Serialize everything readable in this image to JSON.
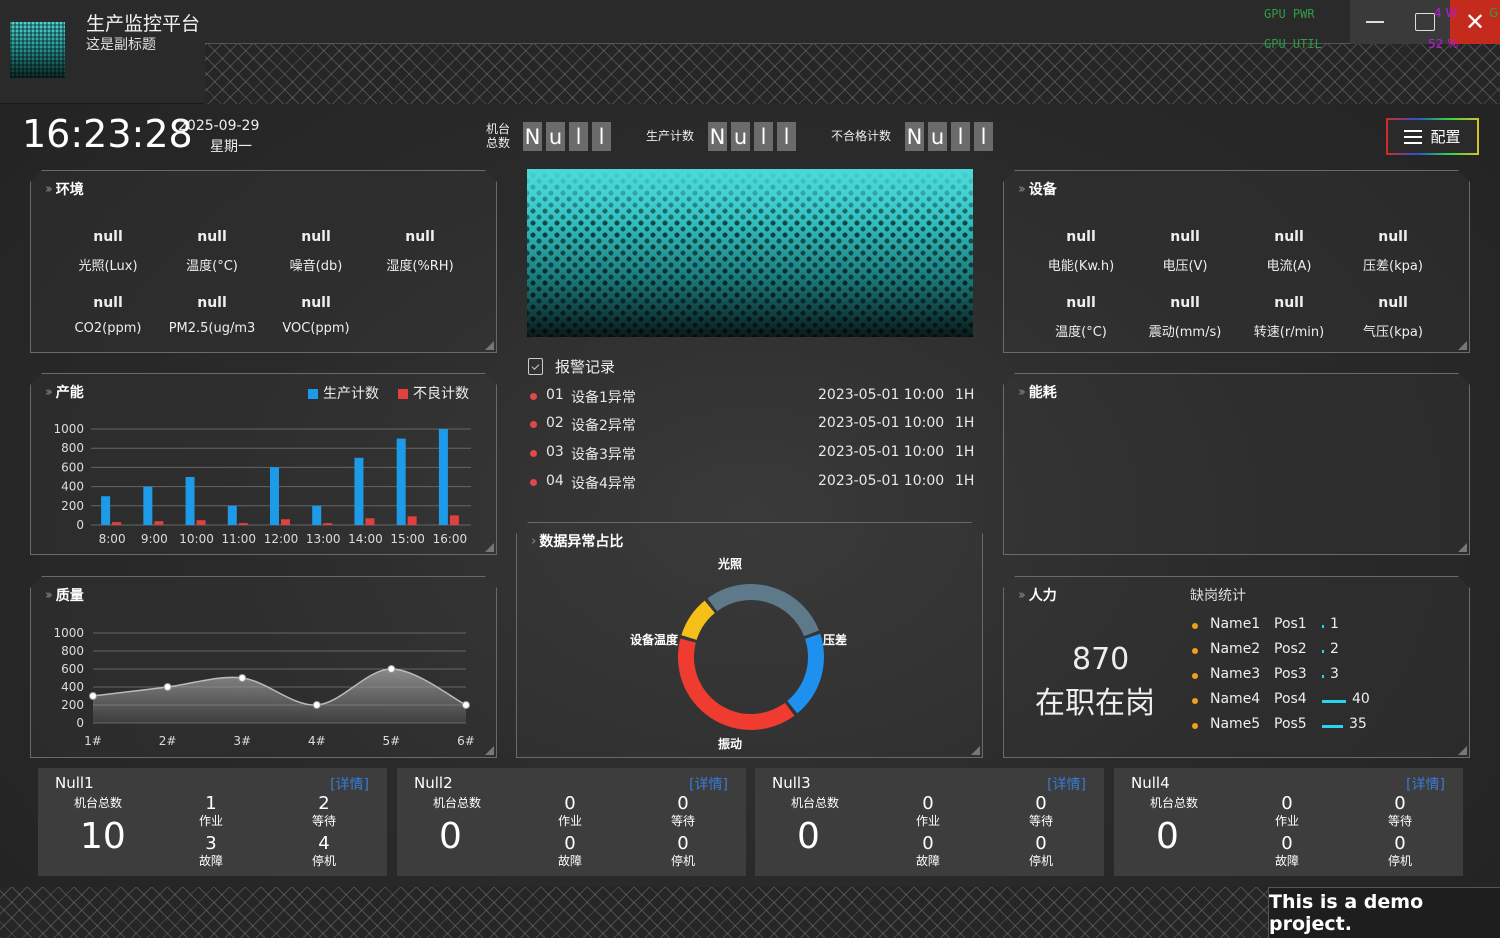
{
  "header": {
    "title": "生产监控平台",
    "subtitle": "这是副标题",
    "gpu_pwr": "GPU PWR",
    "gpu_util": "GPU UTIL",
    "overlay1": "4 W",
    "overlay2": "52 %",
    "overlay3": "G"
  },
  "info": {
    "time": "16:23:28",
    "date": "2025-09-29",
    "weekday": "星期一",
    "machine_total_label1": "机台",
    "machine_total_label2": "总数",
    "machine_total_digits": [
      "N",
      "u",
      "l",
      "l"
    ],
    "production_label": "生产计数",
    "production_digits": [
      "N",
      "u",
      "l",
      "l"
    ],
    "defect_label": "不合格计数",
    "defect_digits": [
      "N",
      "u",
      "l",
      "l"
    ],
    "config_label": "配置"
  },
  "environment": {
    "title": "环境",
    "metrics": [
      {
        "value": "null",
        "label": "光照(Lux)"
      },
      {
        "value": "null",
        "label": "温度(°C)"
      },
      {
        "value": "null",
        "label": "噪音(db)"
      },
      {
        "value": "null",
        "label": "湿度(%RH)"
      },
      {
        "value": "null",
        "label": "CO2(ppm)"
      },
      {
        "value": "null",
        "label": "PM2.5(ug/m3"
      },
      {
        "value": "null",
        "label": "VOC(ppm)"
      }
    ]
  },
  "equipment": {
    "title": "设备",
    "metrics": [
      {
        "value": "null",
        "label": "电能(Kw.h)"
      },
      {
        "value": "null",
        "label": "电压(V)"
      },
      {
        "value": "null",
        "label": "电流(A)"
      },
      {
        "value": "null",
        "label": "压差(kpa)"
      },
      {
        "value": "null",
        "label": "温度(°C)"
      },
      {
        "value": "null",
        "label": "震动(mm/s)"
      },
      {
        "value": "null",
        "label": "转速(r/min)"
      },
      {
        "value": "null",
        "label": "气压(kpa)"
      }
    ]
  },
  "capacity": {
    "title": "产能"
  },
  "quality": {
    "title": "质量"
  },
  "energy": {
    "title": "能耗"
  },
  "anomaly": {
    "title": "数据异常占比"
  },
  "alarms": {
    "title": "报警记录",
    "rows": [
      {
        "no": "01",
        "name": "设备1异常",
        "time": "2023-05-01 10:00",
        "duration": "1H"
      },
      {
        "no": "02",
        "name": "设备2异常",
        "time": "2023-05-01 10:00",
        "duration": "1H"
      },
      {
        "no": "03",
        "name": "设备3异常",
        "time": "2023-05-01 10:00",
        "duration": "1H"
      },
      {
        "no": "04",
        "name": "设备4异常",
        "time": "2023-05-01 10:00",
        "duration": "1H"
      }
    ]
  },
  "workforce": {
    "title": "人力",
    "count": "870",
    "count_label": "在职在岗",
    "stat_title": "缺岗统计",
    "rows": [
      {
        "name": "Name1",
        "pos": "Pos1",
        "value": 1
      },
      {
        "name": "Name2",
        "pos": "Pos2",
        "value": 2
      },
      {
        "name": "Name3",
        "pos": "Pos3",
        "value": 3
      },
      {
        "name": "Name4",
        "pos": "Pos4",
        "value": 40
      },
      {
        "name": "Name5",
        "pos": "Pos5",
        "value": 35
      }
    ]
  },
  "cards": [
    {
      "name": "Null1",
      "detail": "[详情]",
      "total_label": "机台总数",
      "total": "10",
      "cells": [
        {
          "n": "1",
          "t": "作业"
        },
        {
          "n": "2",
          "t": "等待"
        },
        {
          "n": "3",
          "t": "故障"
        },
        {
          "n": "4",
          "t": "停机"
        }
      ]
    },
    {
      "name": "Null2",
      "detail": "[详情]",
      "total_label": "机台总数",
      "total": "0",
      "cells": [
        {
          "n": "0",
          "t": "作业"
        },
        {
          "n": "0",
          "t": "等待"
        },
        {
          "n": "0",
          "t": "故障"
        },
        {
          "n": "0",
          "t": "停机"
        }
      ]
    },
    {
      "name": "Null3",
      "detail": "[详情]",
      "total_label": "机台总数",
      "total": "0",
      "cells": [
        {
          "n": "0",
          "t": "作业"
        },
        {
          "n": "0",
          "t": "等待"
        },
        {
          "n": "0",
          "t": "故障"
        },
        {
          "n": "0",
          "t": "停机"
        }
      ]
    },
    {
      "name": "Null4",
      "detail": "[详情]",
      "total_label": "机台总数",
      "total": "0",
      "cells": [
        {
          "n": "0",
          "t": "作业"
        },
        {
          "n": "0",
          "t": "等待"
        },
        {
          "n": "0",
          "t": "故障"
        },
        {
          "n": "0",
          "t": "停机"
        }
      ]
    }
  ],
  "footer": {
    "text": "This is a demo project."
  },
  "colors": {
    "accent_blue": "#1e9be8",
    "accent_red": "#e04040",
    "accent_cyan": "#2ad4f0",
    "dot_orange": "#f0a020"
  },
  "chart_data": [
    {
      "type": "bar",
      "categories": [
        "8:00",
        "9:00",
        "10:00",
        "11:00",
        "12:00",
        "13:00",
        "14:00",
        "15:00",
        "16:00"
      ],
      "series": [
        {
          "name": "生产计数",
          "color": "#1e9be8",
          "values": [
            300,
            400,
            500,
            200,
            600,
            200,
            700,
            900,
            1000
          ]
        },
        {
          "name": "不良计数",
          "color": "#e04040",
          "values": [
            30,
            40,
            50,
            20,
            60,
            20,
            70,
            90,
            100
          ]
        }
      ],
      "ylim": [
        0,
        1000
      ],
      "yticks": [
        0,
        200,
        400,
        600,
        800,
        1000
      ],
      "legend": "top-right",
      "grid": true
    },
    {
      "type": "area",
      "categories": [
        "1#",
        "2#",
        "3#",
        "4#",
        "5#",
        "6#"
      ],
      "values": [
        300,
        400,
        500,
        200,
        600,
        200
      ],
      "ylim": [
        0,
        1000
      ],
      "yticks": [
        0,
        200,
        400,
        600,
        800,
        1000
      ],
      "grid": true
    },
    {
      "type": "pie",
      "labels": [
        "光照",
        "压差",
        "振动",
        "设备温度"
      ],
      "values": [
        30,
        20,
        40,
        10
      ],
      "colors": [
        "#5e7a8a",
        "#1e90f0",
        "#f03c30",
        "#f5c018"
      ]
    }
  ]
}
